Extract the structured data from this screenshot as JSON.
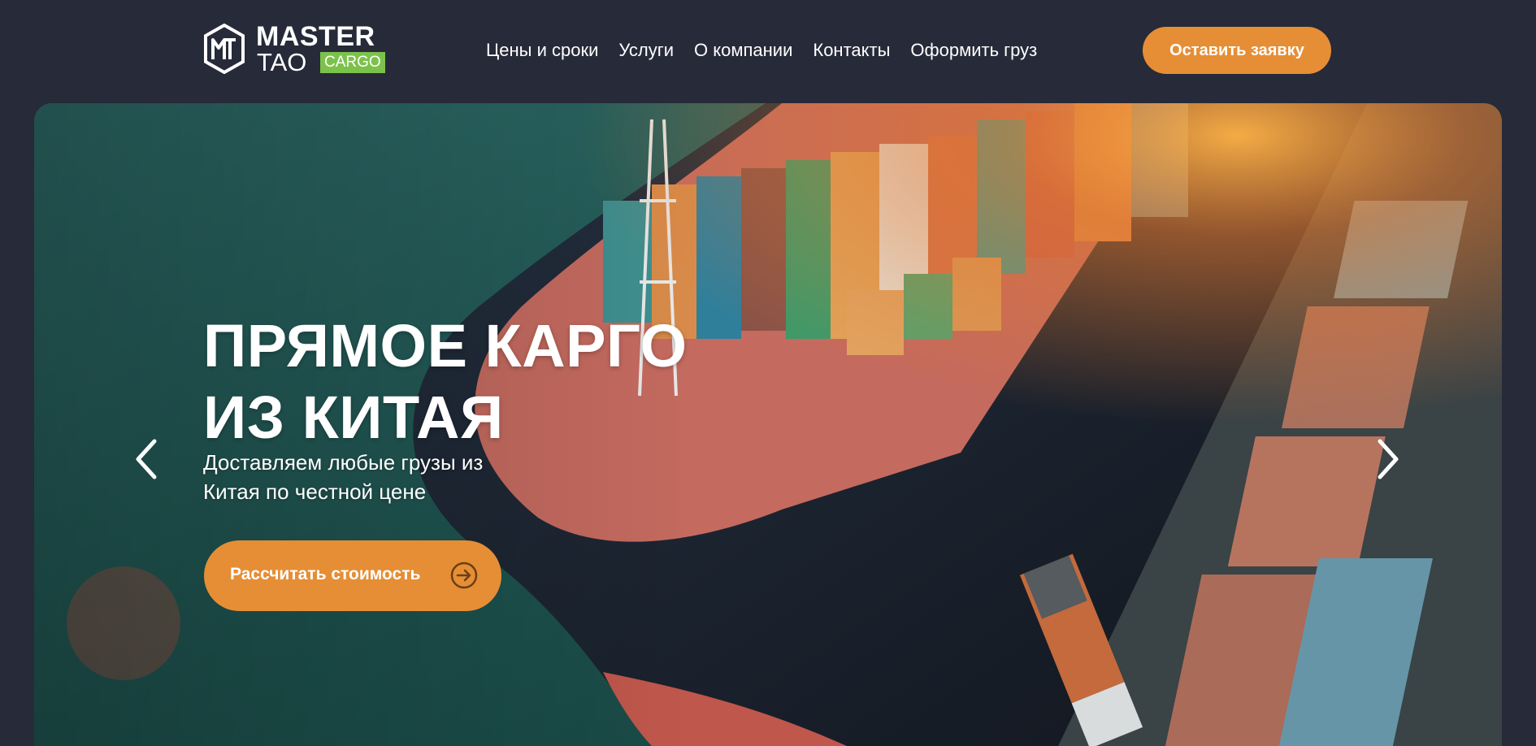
{
  "header": {
    "logo": {
      "monogram": "MT",
      "word1": "MASTER",
      "word2": "TAO",
      "badge": "CARGO"
    },
    "nav": [
      {
        "label": "Цены и сроки"
      },
      {
        "label": "Услуги"
      },
      {
        "label": "О компании"
      },
      {
        "label": "Контакты"
      },
      {
        "label": "Оформить груз"
      }
    ],
    "cta_label": "Оставить заявку"
  },
  "hero": {
    "title_line1": "ПРЯМОЕ КАРГО",
    "title_line2": "ИЗ КИТАЯ",
    "subtitle_line1": "Доставляем любые грузы из",
    "subtitle_line2": "Китая по честной цене",
    "cta_label": "Рассчитать стоимость",
    "cta_icon": "arrow-right-circle-icon",
    "prev_icon": "chevron-left-icon",
    "next_icon": "chevron-right-icon"
  },
  "colors": {
    "page_bg": "#272a38",
    "accent": "#e68e35",
    "badge_green": "#7cc24a",
    "text": "#ffffff"
  }
}
